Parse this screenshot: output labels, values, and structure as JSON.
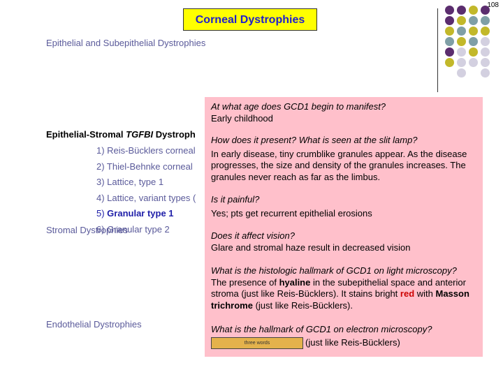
{
  "page_number": "108",
  "title": "Corneal Dystrophies",
  "sections": {
    "epithelial": "Epithelial and Subepithelial Dystrophies",
    "epithelial_stromal_prefix": "Epithelial-Stromal ",
    "epithelial_stromal_gene": "TGFBI",
    "epithelial_stromal_suffix": " Dystroph",
    "stromal": "Stromal Dystrophies",
    "endothelial": "Endothelial Dystrophies"
  },
  "list": [
    "1) Reis-Bücklers corneal",
    "2) Thiel-Behnke corneal",
    "3) Lattice, type 1",
    "4) Lattice, variant types (",
    {
      "num": "5) ",
      "label": "Granular type 1"
    },
    "6) Granular type 2"
  ],
  "qa": {
    "q1": "At what age does GCD1 begin to manifest?",
    "a1": "Early childhood",
    "q2": "How does it present? What is seen at the slit lamp?",
    "a2": "In early disease, tiny crumblike granules appear. As the disease progresses, the size and density of the granules increases. The granules never reach as far as the limbus.",
    "q3": "Is it painful?",
    "a3": "Yes; pts get recurrent epithelial erosions",
    "q4": "Does it affect vision?",
    "a4": "Glare and stromal haze result in decreased vision",
    "q5": "What is the histologic hallmark of GCD1 on light microscopy?",
    "a5_parts": [
      "The presence of ",
      "hyaline",
      " in the subepithelial space and anterior stroma (just like Reis-Bücklers). It stains bright ",
      "red",
      " with ",
      "Masson trichrome",
      " (just like Reis-Bücklers)."
    ],
    "q6": "What is the hallmark of GCD1 on electron microscopy?",
    "a6_blank": "three words",
    "a6_suffix": "(just like Reis-Bücklers)"
  },
  "colors": {
    "title_bg": "#ffff00",
    "title_text": "#1f1fcf",
    "panel_bg": "#ffc0cb",
    "dot_purple": "#5b2d6e",
    "dot_teal": "#7f9fa6",
    "dot_olive": "#c2b82a",
    "dot_lavender": "#d3d0e0"
  }
}
